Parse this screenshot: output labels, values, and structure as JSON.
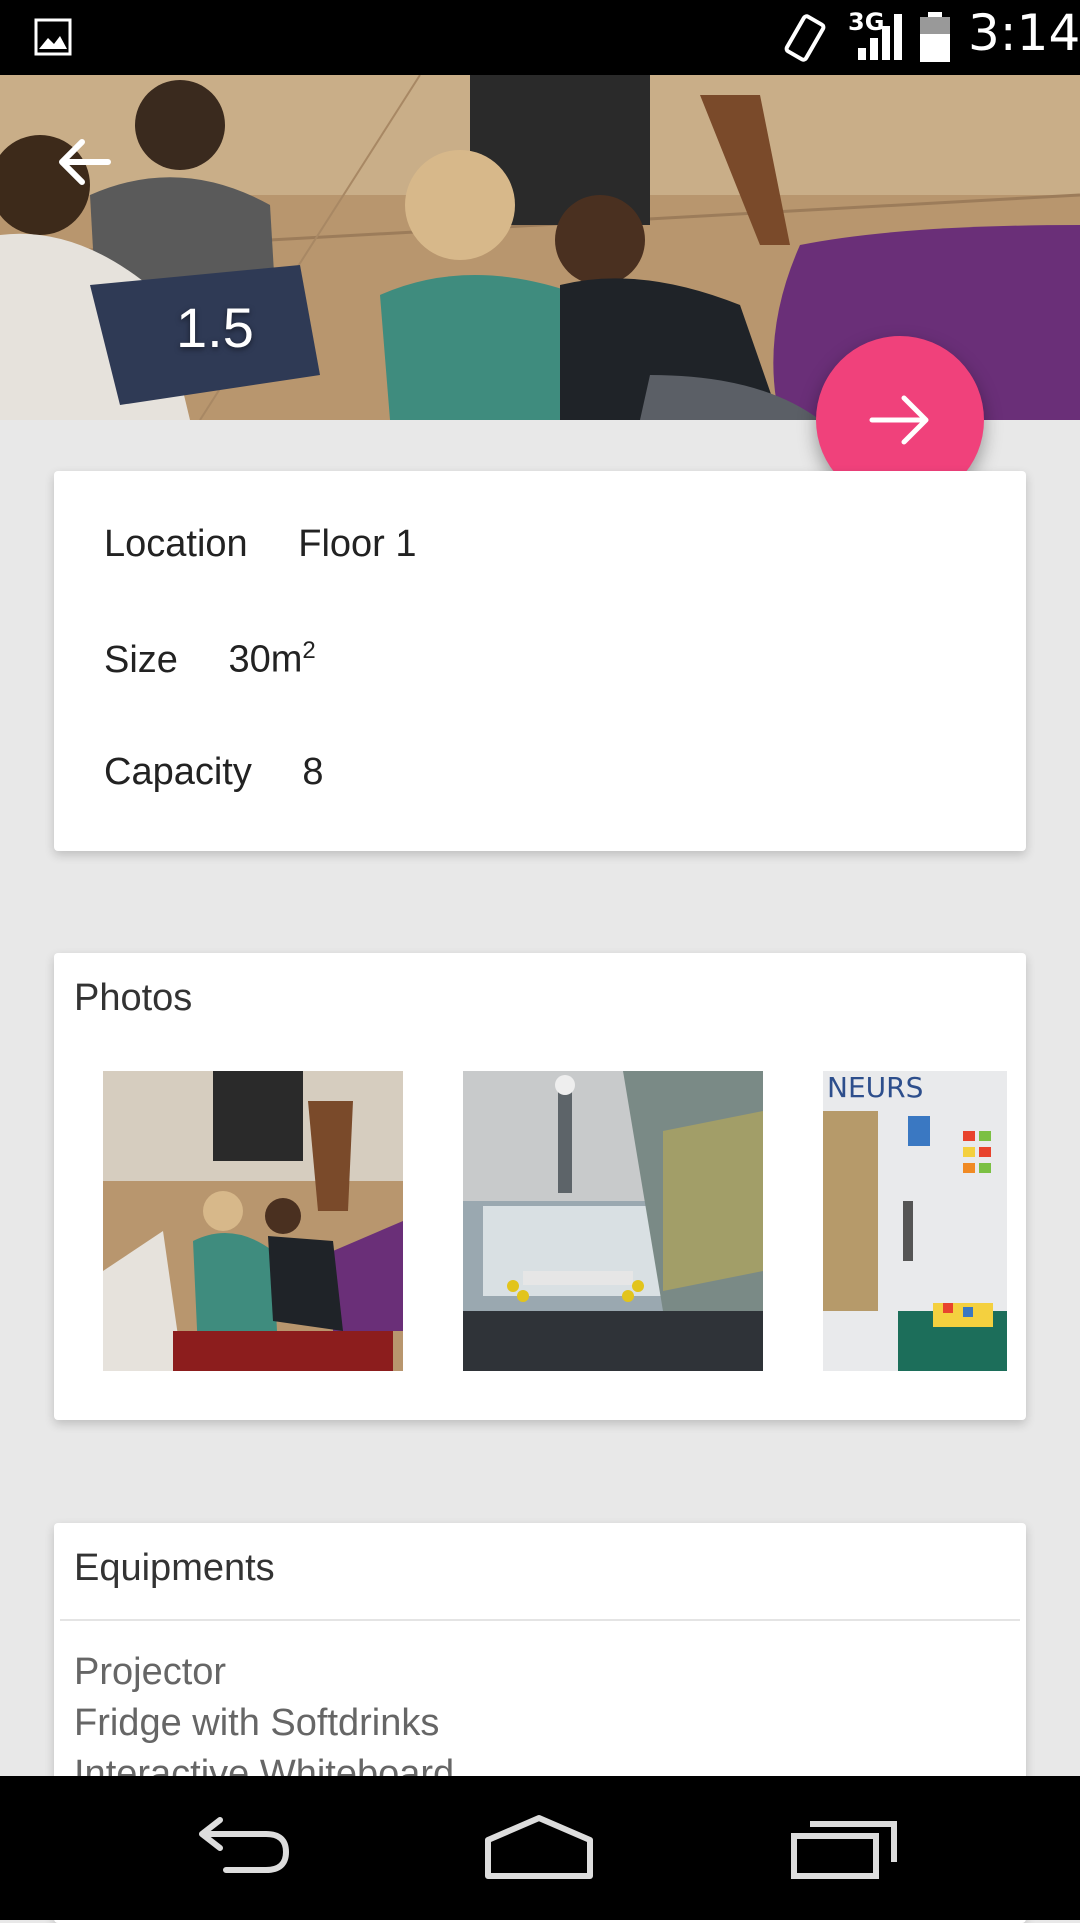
{
  "status_bar": {
    "time": "3:14",
    "network": "3G",
    "icons": [
      "image-icon",
      "rotate-icon",
      "signal-icon",
      "battery-icon"
    ]
  },
  "hero": {
    "room_number": "1.5",
    "back_icon": "arrow-left-icon"
  },
  "fab": {
    "icon": "arrow-right-icon",
    "color": "#f0417b"
  },
  "details": {
    "location_label": "Location",
    "location_value": "Floor 1",
    "size_label": "Size",
    "size_value": "30m",
    "size_unit_sup": "2",
    "capacity_label": "Capacity",
    "capacity_value": "8"
  },
  "photos": {
    "title": "Photos"
  },
  "equipments": {
    "title": "Equipments",
    "items": [
      "Projector",
      "Fridge with Softdrinks",
      "Interactive Whiteboard"
    ]
  },
  "nav_bar": {
    "icons": [
      "back-icon",
      "home-icon",
      "recent-apps-icon"
    ]
  }
}
